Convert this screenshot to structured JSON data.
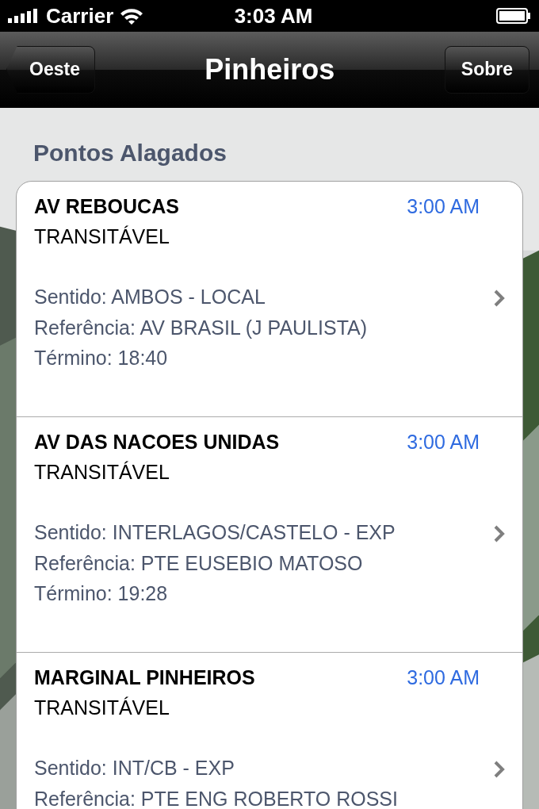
{
  "status_bar": {
    "carrier": "Carrier",
    "time": "3:03 AM"
  },
  "nav_bar": {
    "back_button": "Oeste",
    "title": "Pinheiros",
    "right_button": "Sobre"
  },
  "section_header": "Pontos Alagados",
  "rows": [
    {
      "title": "AV REBOUCAS",
      "time": "3:00 AM",
      "status": "TRANSITÁVEL",
      "details": [
        "Sentido: AMBOS - LOCAL",
        "Referência: AV BRASIL (J PAULISTA)",
        "Término: 18:40"
      ]
    },
    {
      "title": "AV DAS NACOES UNIDAS",
      "time": "3:00 AM",
      "status": "TRANSITÁVEL",
      "details": [
        "Sentido: INTERLAGOS/CASTELO - EXP",
        "Referência: PTE EUSEBIO MATOSO",
        "Término: 19:28"
      ]
    },
    {
      "title": "MARGINAL PINHEIROS",
      "time": "3:00 AM",
      "status": "TRANSITÁVEL",
      "details": [
        "Sentido: INT/CB - EXP",
        "Referência: PTE ENG ROBERTO ROSSI"
      ]
    }
  ]
}
